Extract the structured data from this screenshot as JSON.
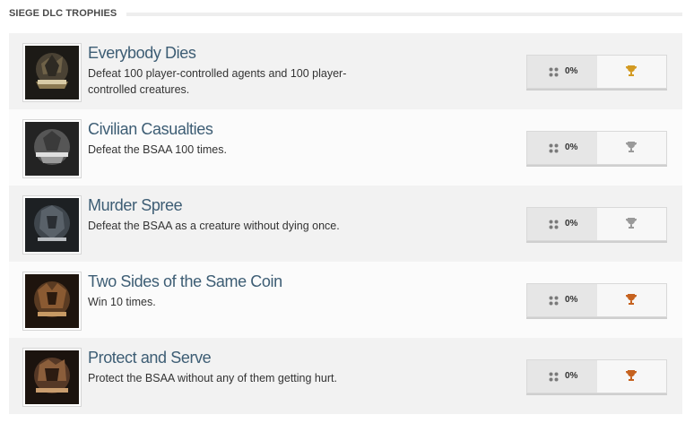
{
  "section": {
    "title": "SIEGE DLC TROPHIES"
  },
  "trophies": [
    {
      "title": "Everybody Dies",
      "description": "Defeat 100 player-controlled agents and 100 player-controlled creatures.",
      "percent": "0%",
      "grade": "gold",
      "icon": "trophy-icon",
      "color": "#d39a22"
    },
    {
      "title": "Civilian Casualties",
      "description": "Defeat the BSAA 100 times.",
      "percent": "0%",
      "grade": "silver",
      "icon": "trophy-icon",
      "color": "#9a9a9a"
    },
    {
      "title": "Murder Spree",
      "description": "Defeat the BSAA as a creature without dying once.",
      "percent": "0%",
      "grade": "silver",
      "icon": "trophy-icon",
      "color": "#9a9a9a"
    },
    {
      "title": "Two Sides of the Same Coin",
      "description": "Win 10 times.",
      "percent": "0%",
      "grade": "bronze",
      "icon": "trophy-icon",
      "color": "#c6621f"
    },
    {
      "title": "Protect and Serve",
      "description": "Protect the BSAA without any of them getting hurt.",
      "percent": "0%",
      "grade": "bronze",
      "icon": "trophy-icon",
      "color": "#c6621f"
    }
  ]
}
